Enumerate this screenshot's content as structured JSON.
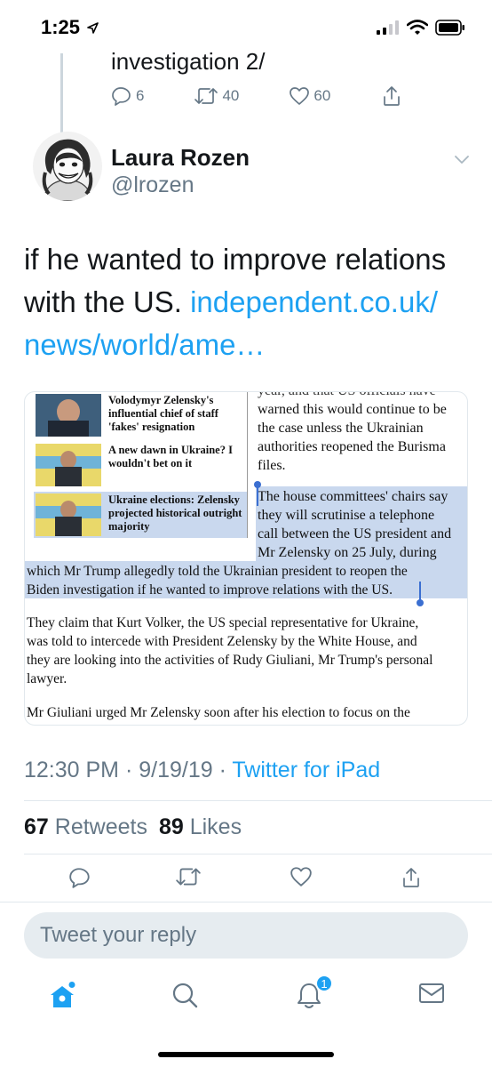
{
  "status_bar": {
    "time": "1:25"
  },
  "previous_tweet": {
    "text": "investigation 2/",
    "replies": "6",
    "retweets": "40",
    "likes": "60"
  },
  "tweet": {
    "author_name": "Laura Rozen",
    "author_handle": "@lrozen",
    "text_prefix": "if he wanted to improve relations with the US.",
    "link_text": "independent.co.uk/ news/world/ame…",
    "time": "12:30 PM · 9/19/19 ·",
    "source": "Twitter for iPad",
    "retweet_count": "67",
    "retweets_label": "Retweets",
    "like_count": "89",
    "likes_label": "Likes"
  },
  "media": {
    "related": [
      "Volodymyr Zelensky's influential chief of staff 'fakes' resignation",
      "A new dawn in Ukraine? I wouldn't bet on it",
      "Ukraine elections: Zelensky projected historical outright majority"
    ],
    "col_top": "year, and that US officials have",
    "col_lines": [
      "warned this would continue to be",
      "the case unless the Ukrainian",
      "authorities reopened the Burisma",
      "files."
    ],
    "hl_col_lines": [
      "The house committees' chairs say",
      "they will scrutinise a telephone",
      "call between the US president and",
      "Mr Zelensky on 25 July, during"
    ],
    "hl_full_lines": [
      "which Mr Trump allegedly told the Ukrainian president to reopen the",
      "Biden investigation if he wanted to improve relations with the US."
    ],
    "para2_lines": [
      "They claim that Kurt Volker, the US special representative for Ukraine,",
      "was told to intercede with President Zelensky by the White House, and",
      "they are looking into the activities of Rudy Giuliani, Mr Trump's personal",
      "lawyer."
    ],
    "para3_line": "Mr Giuliani urged Mr Zelensky soon after his election to focus on the"
  },
  "reply": {
    "placeholder": "Tweet your reply"
  },
  "tabbar": {
    "notification_badge": "1"
  },
  "colors": {
    "accent": "#1da1f2",
    "secondary_text": "#657786",
    "highlight": "#c9d8ee"
  }
}
